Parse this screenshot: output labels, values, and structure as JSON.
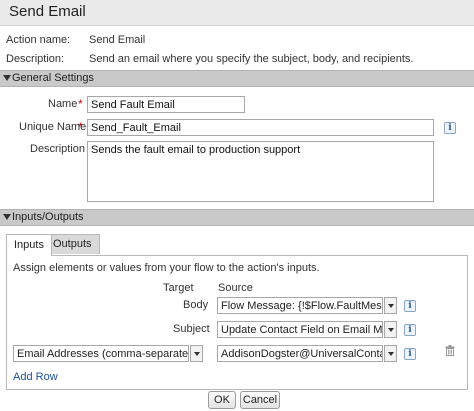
{
  "window": {
    "title": "Send Email"
  },
  "header": {
    "action_name_label": "Action name:",
    "action_name_value": "Send Email",
    "description_label": "Description:",
    "description_value": "Send an email where you specify the subject, body, and recipients."
  },
  "general": {
    "section_title": "General Settings",
    "name_label": "Name",
    "name_value": "Send Fault Email",
    "unique_name_label": "Unique Name",
    "unique_name_value": "Send_Fault_Email",
    "description_label": "Description",
    "description_value": "Sends the fault email to production support"
  },
  "io": {
    "section_title": "Inputs/Outputs",
    "tabs": [
      {
        "label": "Inputs"
      },
      {
        "label": "Outputs"
      }
    ],
    "instruction": "Assign elements or values from your flow to the action's inputs.",
    "target_header": "Target",
    "source_header": "Source",
    "rows": [
      {
        "target": "Body",
        "source": "Flow Message: {!$Flow.FaultMessage}"
      },
      {
        "target": "Subject",
        "source": "Update Contact Field on Email Message"
      },
      {
        "target": "Email Addresses (comma-separated)",
        "source": "AddisonDogster@UniversalContainers.com"
      }
    ],
    "add_row": "Add Row"
  },
  "footer": {
    "ok": "OK",
    "cancel": "Cancel"
  },
  "colors": {
    "section_bg": "#c9c9c9",
    "link": "#1a4f9c",
    "required": "#cc0000"
  }
}
